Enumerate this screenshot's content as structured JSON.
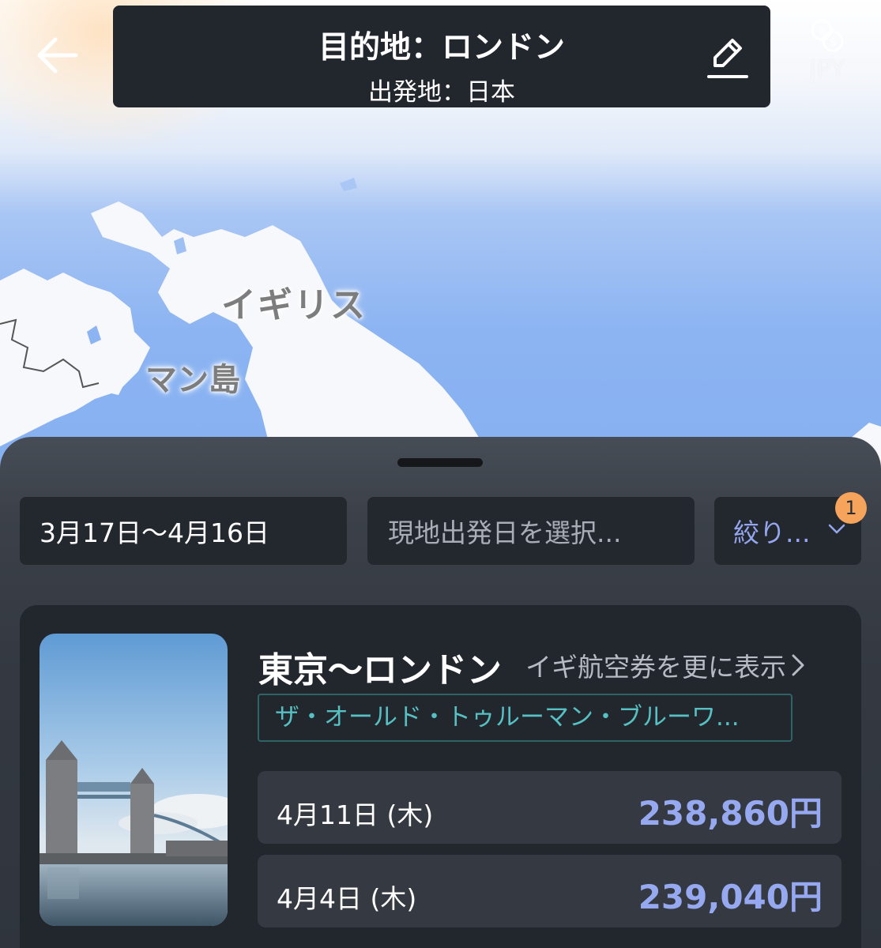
{
  "header": {
    "destination_title": "目的地：ロンドン",
    "origin_subtitle": "出発地：日本",
    "currency": "JPY"
  },
  "map": {
    "country_label": "イギリス",
    "island_label": "マン島"
  },
  "filters": {
    "date_range": "3月17日〜4月16日",
    "local_departure_placeholder": "現地出発日を選択...",
    "refine_label": "絞り...",
    "refine_badge_count": "1"
  },
  "result_card": {
    "route": "東京〜ロンドン",
    "more_link": "イギ航空券を更に表示",
    "hotel_tag": "ザ・オールド・トゥルーマン・ブルーワ...",
    "fares": [
      {
        "date": "4月11日 (木)",
        "price": "238,860円"
      },
      {
        "date": "4月4日 (木)",
        "price": "239,040円"
      }
    ]
  },
  "colors": {
    "accent_price": "#96a8f0",
    "tag_teal": "#56c0c3",
    "badge_orange": "#f6a35c",
    "sheet_bg": "#343941",
    "card_bg": "#22262d"
  },
  "icons": [
    "back-arrow-icon",
    "edit-pencil-icon",
    "currency-exchange-icon",
    "chevron-down-icon",
    "chevron-right-icon"
  ]
}
